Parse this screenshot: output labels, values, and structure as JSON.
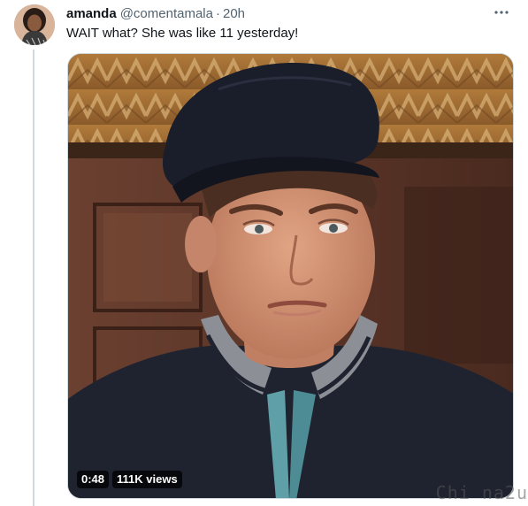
{
  "tweet": {
    "display_name": "amanda",
    "handle": "@comentamala",
    "separator": "·",
    "time": "20h",
    "text": "WAIT what? She was like 11 yesterday!",
    "more_icon": "more-horizontal-icon",
    "media": {
      "type": "video",
      "duration": "0:48",
      "views": "111K views"
    }
  },
  "watermark": "Chi na2u",
  "colors": {
    "text_primary": "#0f1419",
    "text_secondary": "#536471",
    "thread_line": "#cfd9de",
    "badge_bg": "#000000"
  }
}
